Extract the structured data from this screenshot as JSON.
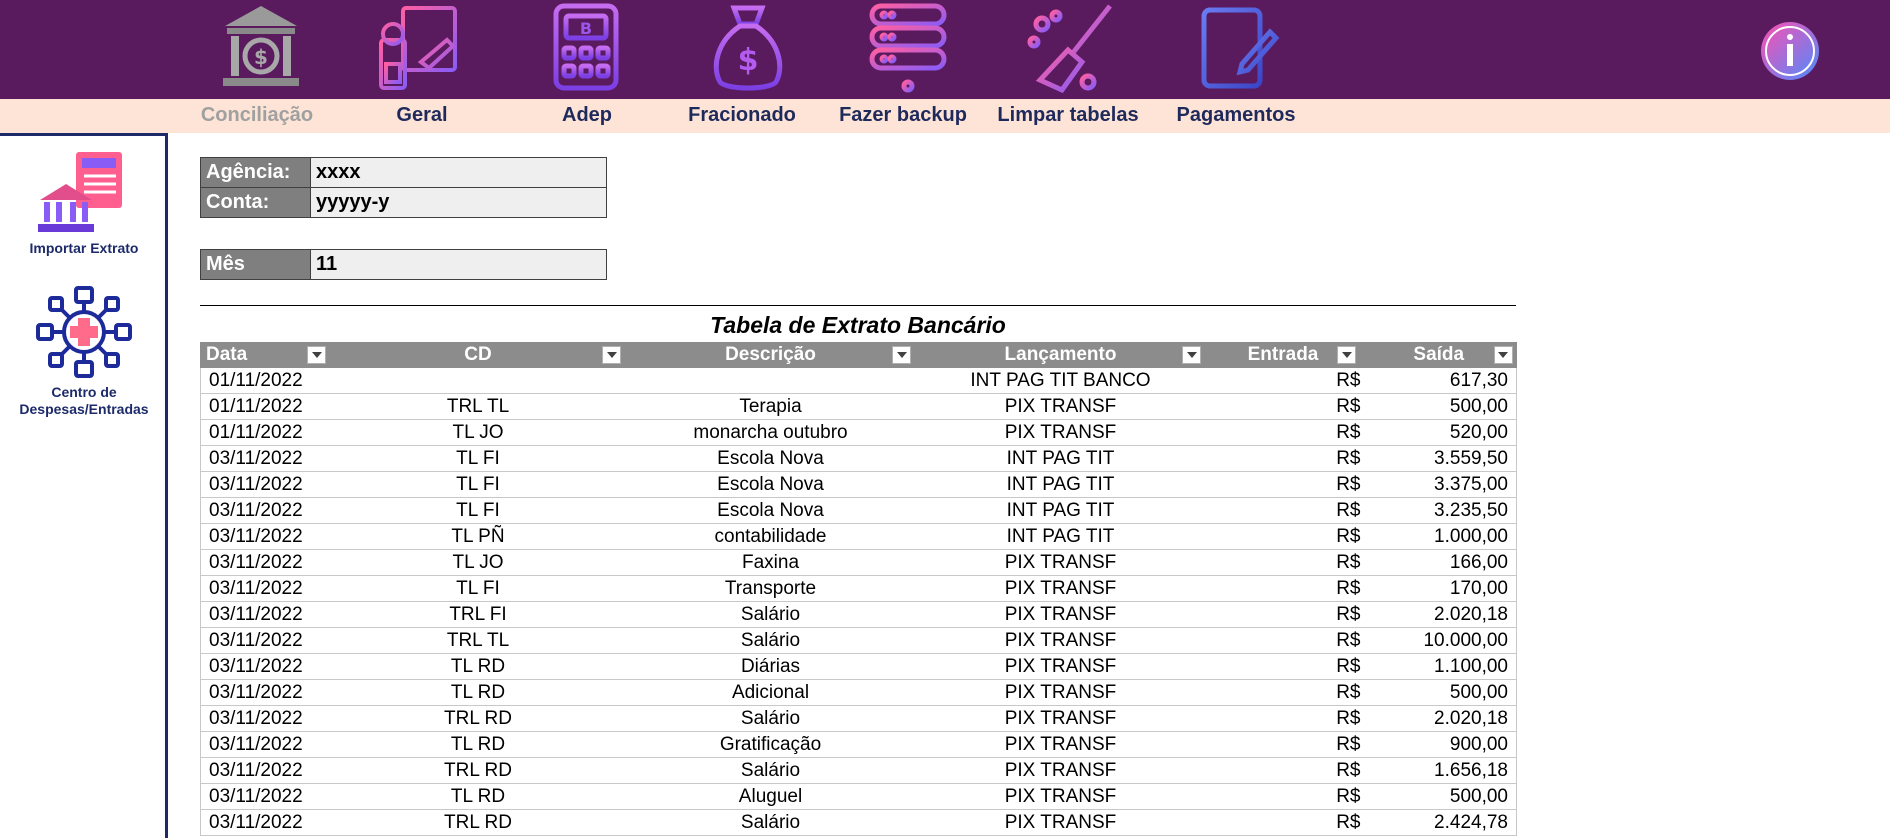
{
  "nav": [
    {
      "label": "Conciliação",
      "icon": "bank-icon",
      "active": false
    },
    {
      "label": "Geral",
      "icon": "cashier-icon"
    },
    {
      "label": "Adep",
      "icon": "bitcoin-calculator-icon"
    },
    {
      "label": "Fracionado",
      "icon": "money-bag-icon"
    },
    {
      "label": "Fazer backup",
      "icon": "server-backup-icon"
    },
    {
      "label": "Limpar tabelas",
      "icon": "broom-icon"
    },
    {
      "label": "Pagamentos",
      "icon": "document-edit-icon"
    }
  ],
  "info_icon": "info-icon",
  "sidebar": [
    {
      "label_1": "Importar Extrato",
      "label_2": "",
      "icon": "import-statement-icon"
    },
    {
      "label_1": "Centro de",
      "label_2": "Despesas/Entradas",
      "icon": "expense-center-icon"
    }
  ],
  "fields": {
    "agencia": {
      "label": "Agência:",
      "value": "xxxx"
    },
    "conta": {
      "label": "Conta:",
      "value": "yyyyy-y"
    },
    "mes": {
      "label": "Mês",
      "value": "11"
    }
  },
  "table": {
    "title": "Tabela de Extrato Bancário",
    "headers": [
      "Data",
      "CD",
      "Descrição",
      "Lançamento",
      "Entrada",
      "Saída"
    ],
    "rows": [
      {
        "data": "01/11/2022",
        "cd": "",
        "descricao": "",
        "lancamento": "INT  PAG TIT BANCO",
        "entrada": "R$",
        "saida": "617,30"
      },
      {
        "data": "01/11/2022",
        "cd": "TRL TL",
        "descricao": "Terapia",
        "lancamento": "PIX TRANSF",
        "entrada": "R$",
        "saida": "500,00"
      },
      {
        "data": "01/11/2022",
        "cd": "TL JO",
        "descricao": "monarcha outubro",
        "lancamento": "PIX TRANSF",
        "entrada": "R$",
        "saida": "520,00"
      },
      {
        "data": "03/11/2022",
        "cd": "TL FI",
        "descricao": "Escola Nova",
        "lancamento": "INT  PAG TIT",
        "entrada": "R$",
        "saida": "3.559,50"
      },
      {
        "data": "03/11/2022",
        "cd": "TL FI",
        "descricao": "Escola Nova",
        "lancamento": "INT  PAG TIT",
        "entrada": "R$",
        "saida": "3.375,00"
      },
      {
        "data": "03/11/2022",
        "cd": "TL FI",
        "descricao": "Escola Nova",
        "lancamento": "INT  PAG TIT",
        "entrada": "R$",
        "saida": "3.235,50"
      },
      {
        "data": "03/11/2022",
        "cd": "TL PÑ",
        "descricao": "contabilidade",
        "lancamento": "INT  PAG TIT",
        "entrada": "R$",
        "saida": "1.000,00"
      },
      {
        "data": "03/11/2022",
        "cd": "TL JO",
        "descricao": "Faxina",
        "lancamento": "PIX TRANSF",
        "entrada": "R$",
        "saida": "166,00"
      },
      {
        "data": "03/11/2022",
        "cd": "TL FI",
        "descricao": "Transporte",
        "lancamento": "PIX TRANSF",
        "entrada": "R$",
        "saida": "170,00"
      },
      {
        "data": "03/11/2022",
        "cd": "TRL FI",
        "descricao": "Salário",
        "lancamento": "PIX TRANSF",
        "entrada": "R$",
        "saida": "2.020,18"
      },
      {
        "data": "03/11/2022",
        "cd": "TRL TL",
        "descricao": "Salário",
        "lancamento": "PIX TRANSF",
        "entrada": "R$",
        "saida": "10.000,00"
      },
      {
        "data": "03/11/2022",
        "cd": "TL RD",
        "descricao": "Diárias",
        "lancamento": "PIX TRANSF",
        "entrada": "R$",
        "saida": "1.100,00"
      },
      {
        "data": "03/11/2022",
        "cd": "TL RD",
        "descricao": "Adicional",
        "lancamento": "PIX TRANSF",
        "entrada": "R$",
        "saida": "500,00"
      },
      {
        "data": "03/11/2022",
        "cd": "TRL RD",
        "descricao": "Salário",
        "lancamento": "PIX TRANSF",
        "entrada": "R$",
        "saida": "2.020,18"
      },
      {
        "data": "03/11/2022",
        "cd": "TL RD",
        "descricao": "Gratificação",
        "lancamento": "PIX TRANSF",
        "entrada": "R$",
        "saida": "900,00"
      },
      {
        "data": "03/11/2022",
        "cd": "TRL RD",
        "descricao": "Salário",
        "lancamento": "PIX TRANSF",
        "entrada": "R$",
        "saida": "1.656,18"
      },
      {
        "data": "03/11/2022",
        "cd": "TL RD",
        "descricao": "Aluguel",
        "lancamento": "PIX TRANSF",
        "entrada": "R$",
        "saida": "500,00"
      },
      {
        "data": "03/11/2022",
        "cd": "TRL RD",
        "descricao": "Salário",
        "lancamento": "PIX TRANSF",
        "entrada": "R$",
        "saida": "2.424,78"
      }
    ]
  },
  "colors": {
    "ribbon": "#5a1a5e",
    "label_bar": "#fde4d6",
    "nav_text": "#1f2a5c",
    "header_gray": "#8c8c8c"
  }
}
